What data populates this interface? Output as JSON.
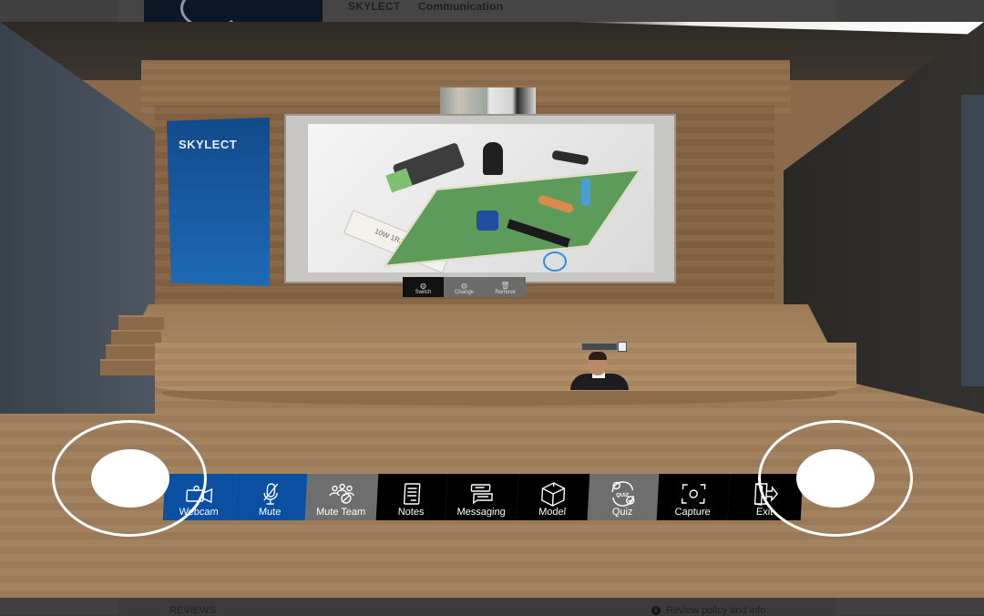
{
  "background_page": {
    "brand": "SKYLECT",
    "nav_label": "Communication",
    "reviews_heading": "REVIEWS",
    "review_policy_link": "Review policy and info"
  },
  "scene": {
    "banner_logo": "SKYLECT",
    "presentation_image": {
      "subject": "electronic circuit board render",
      "resistor_label": "10W 1RJ",
      "highlight_color": "#2a8ee0"
    },
    "screen_controls": [
      {
        "label": "Switch",
        "icon": "globe-icon",
        "active": true
      },
      {
        "label": "Change",
        "icon": "globe-icon",
        "active": false
      },
      {
        "label": "Remove",
        "icon": "trash-icon",
        "active": false
      }
    ]
  },
  "toolbar": {
    "items": [
      {
        "label": "Webcam",
        "icon": "webcam-icon",
        "style": "blue"
      },
      {
        "label": "Mute",
        "icon": "mic-muted-icon",
        "style": "blue"
      },
      {
        "label": "Mute Team",
        "icon": "team-muted-icon",
        "style": "grey"
      },
      {
        "label": "Notes",
        "icon": "notes-icon",
        "style": "black"
      },
      {
        "label": "Messaging",
        "icon": "messaging-icon",
        "style": "black"
      },
      {
        "label": "Model",
        "icon": "cube-icon",
        "style": "black"
      },
      {
        "label": "Quiz",
        "icon": "quiz-icon",
        "style": "grey"
      },
      {
        "label": "Capture",
        "icon": "capture-icon",
        "style": "black"
      },
      {
        "label": "Exit",
        "icon": "exit-icon",
        "style": "black"
      }
    ],
    "quiz_badge": "QUIZ"
  },
  "colors": {
    "accent_blue": "#0b4fa3",
    "inactive_grey": "#6e6e6e",
    "toolbar_black": "#000000"
  }
}
